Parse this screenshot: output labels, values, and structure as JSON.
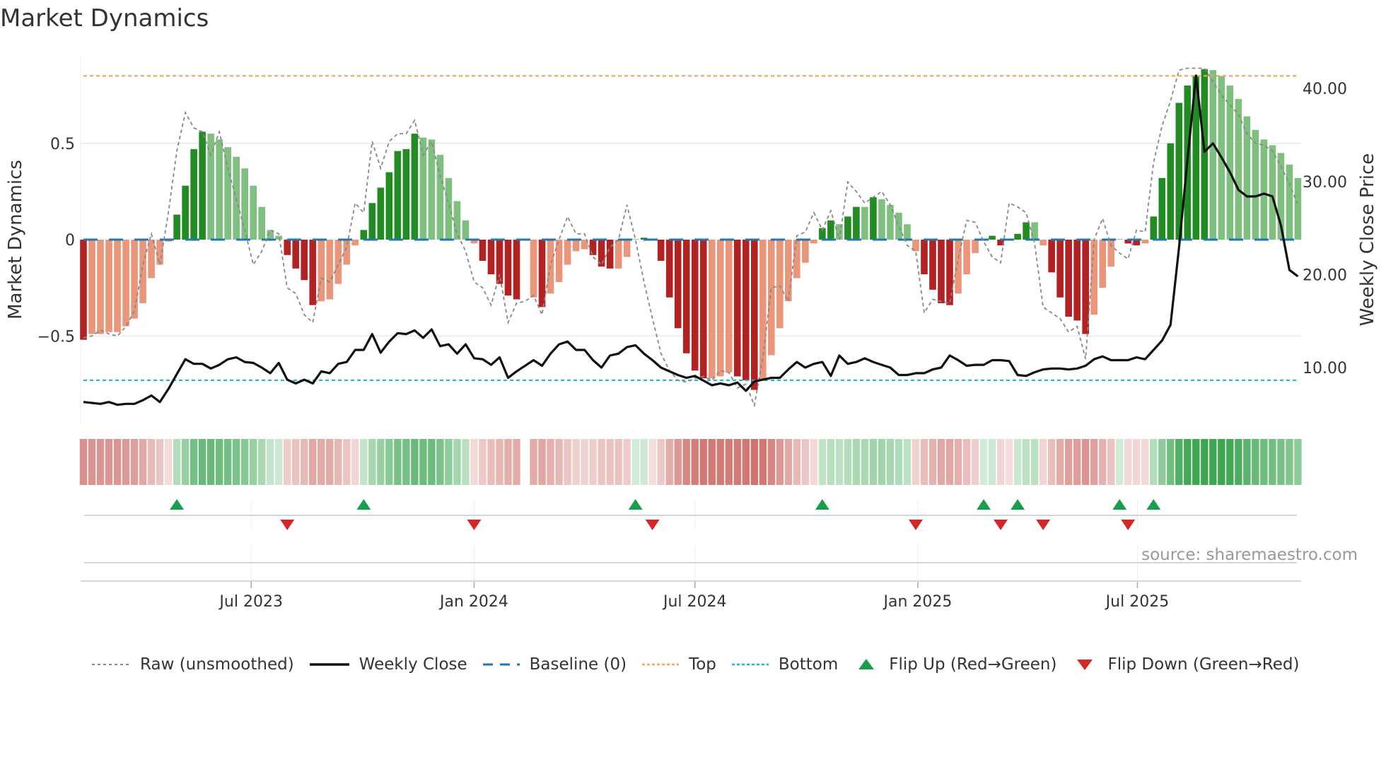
{
  "title": "Market Dynamics",
  "source": "source: sharemaestro.com",
  "colors": {
    "dark_green": "#228b22",
    "light_green": "#7fbf7f",
    "dark_red": "#b22222",
    "light_red": "#e9967a",
    "heat_green": "#3ca651",
    "heat_red": "#cd6b66",
    "raw": "#888888",
    "close": "#111111",
    "baseline": "#1f77b4",
    "top": "#f4a460",
    "bottom": "#17becf",
    "flip_up": "#1a9e4b",
    "flip_down": "#d62728"
  },
  "legend": {
    "raw": "Raw (unsmoothed)",
    "close": "Weekly Close",
    "baseline": "Baseline (0)",
    "top": "Top",
    "bottom": "Bottom",
    "flip_up": "Flip Up (Red→Green)",
    "flip_down": "Flip Down (Green→Red)"
  },
  "chart_data": {
    "type": "bar",
    "title": "Market Dynamics",
    "ylabel": "Market Dynamics",
    "y2label": "Weekly Close Price",
    "ylim": [
      -0.92,
      0.95
    ],
    "y2lim": [
      4.0,
      45.0
    ],
    "yticks": [
      {
        "value": 0.5,
        "label": "0.5"
      },
      {
        "value": 0,
        "label": "0"
      },
      {
        "value": -0.5,
        "label": "−0.5"
      }
    ],
    "y2ticks": [
      {
        "value": 40,
        "label": "40.00"
      },
      {
        "value": 30,
        "label": "30.00"
      },
      {
        "value": 20,
        "label": "20.00"
      },
      {
        "value": 10,
        "label": "10.00"
      }
    ],
    "xticks": [
      {
        "week": 19.75,
        "label": "Jul 2023"
      },
      {
        "week": 46.0,
        "label": "Jan 2024"
      },
      {
        "week": 72.0,
        "label": "Jul 2024"
      },
      {
        "week": 98.25,
        "label": "Jan 2025"
      },
      {
        "week": 124.1,
        "label": "Jul 2025"
      }
    ],
    "top_level": 0.85,
    "bottom_level": -0.73,
    "baseline": 0,
    "smoothed": [
      -0.52,
      -0.49,
      -0.49,
      -0.48,
      -0.48,
      -0.45,
      -0.41,
      -0.33,
      -0.2,
      -0.13,
      -0.01,
      0.13,
      0.28,
      0.47,
      0.56,
      0.55,
      0.52,
      0.48,
      0.43,
      0.37,
      0.28,
      0.17,
      0.05,
      0.02,
      -0.08,
      -0.15,
      -0.21,
      -0.34,
      -0.32,
      -0.31,
      -0.23,
      -0.13,
      -0.03,
      0.05,
      0.19,
      0.27,
      0.35,
      0.46,
      0.47,
      0.55,
      0.53,
      0.52,
      0.44,
      0.32,
      0.2,
      0.1,
      -0.02,
      -0.11,
      -0.18,
      -0.23,
      -0.29,
      -0.31,
      null,
      -0.3,
      -0.35,
      -0.28,
      -0.22,
      -0.13,
      -0.06,
      -0.05,
      -0.08,
      -0.14,
      -0.15,
      -0.15,
      -0.09,
      0.003,
      0.01,
      -0.005,
      -0.11,
      -0.3,
      -0.46,
      -0.59,
      -0.68,
      -0.72,
      -0.72,
      -0.71,
      -0.69,
      -0.71,
      -0.73,
      -0.78,
      -0.73,
      -0.6,
      -0.46,
      -0.32,
      -0.2,
      -0.12,
      -0.02,
      0.06,
      0.1,
      0.08,
      0.12,
      0.17,
      0.17,
      0.22,
      0.21,
      0.18,
      0.14,
      0.08,
      -0.06,
      -0.18,
      -0.26,
      -0.33,
      -0.34,
      -0.28,
      -0.18,
      -0.07,
      0.003,
      0.02,
      -0.03,
      -0.003,
      0.03,
      0.09,
      0.09,
      -0.03,
      -0.17,
      -0.3,
      -0.4,
      -0.42,
      -0.49,
      -0.39,
      -0.25,
      -0.14,
      0.003,
      -0.02,
      -0.03,
      -0.02,
      0.12,
      0.32,
      0.5,
      0.71,
      0.8,
      0.85,
      0.885,
      0.88,
      0.85,
      0.8,
      0.73,
      0.64,
      0.57,
      0.52,
      0.49,
      0.45,
      0.39,
      0.32
    ],
    "raw": [
      -0.51,
      -0.5,
      -0.47,
      -0.49,
      -0.5,
      -0.45,
      -0.37,
      -0.13,
      0.03,
      -0.13,
      0.14,
      0.46,
      0.66,
      0.58,
      0.56,
      0.44,
      0.56,
      0.37,
      0.21,
      0.05,
      -0.13,
      -0.06,
      0.05,
      0.03,
      -0.25,
      -0.28,
      -0.39,
      -0.43,
      -0.2,
      -0.22,
      -0.13,
      -0.04,
      0.19,
      0.14,
      0.51,
      0.37,
      0.51,
      0.55,
      0.55,
      0.62,
      0.44,
      0.51,
      0.33,
      0.19,
      0.03,
      -0.06,
      -0.22,
      -0.25,
      -0.34,
      -0.18,
      -0.43,
      -0.33,
      -0.32,
      -0.29,
      -0.39,
      -0.13,
      0.0,
      0.12,
      0.03,
      0.03,
      -0.09,
      -0.13,
      -0.04,
      0.0,
      0.18,
      0.0,
      -0.22,
      -0.41,
      -0.59,
      -0.68,
      -0.73,
      -0.74,
      -0.72,
      -0.71,
      -0.73,
      -0.68,
      -0.69,
      -0.77,
      -0.75,
      -0.86,
      -0.61,
      -0.25,
      -0.24,
      -0.32,
      0.02,
      0.04,
      0.14,
      0.05,
      0.15,
      0.0,
      0.3,
      0.25,
      0.19,
      0.22,
      0.25,
      0.18,
      0.07,
      -0.03,
      -0.06,
      -0.38,
      -0.31,
      -0.32,
      -0.33,
      -0.1,
      0.1,
      0.09,
      -0.01,
      -0.09,
      -0.12,
      0.19,
      0.17,
      0.14,
      -0.02,
      -0.35,
      -0.38,
      -0.41,
      -0.48,
      -0.45,
      -0.62,
      0.0,
      0.11,
      -0.03,
      -0.07,
      -0.1,
      0.05,
      0.04,
      0.4,
      0.59,
      0.72,
      0.88,
      0.89,
      0.89,
      0.89,
      0.82,
      0.75,
      0.7,
      0.65,
      0.55,
      0.5,
      0.49,
      0.46,
      0.38,
      0.29,
      0.18
    ],
    "close": [
      6.3,
      6.2,
      6.1,
      6.3,
      6.0,
      6.1,
      6.1,
      6.5,
      7.0,
      6.3,
      7.7,
      9.3,
      10.9,
      10.4,
      10.4,
      9.9,
      10.3,
      10.9,
      11.1,
      10.6,
      10.5,
      10.0,
      9.4,
      10.5,
      8.7,
      8.3,
      8.7,
      8.3,
      9.6,
      9.4,
      10.4,
      10.6,
      11.9,
      11.9,
      13.6,
      11.6,
      12.8,
      13.7,
      13.6,
      14.0,
      13.2,
      14.1,
      12.3,
      12.5,
      11.5,
      12.5,
      11.0,
      10.9,
      10.3,
      11.1,
      8.9,
      9.6,
      10.2,
      10.8,
      10.2,
      11.5,
      12.5,
      12.8,
      11.9,
      11.9,
      10.8,
      10.0,
      11.3,
      11.5,
      12.2,
      12.4,
      11.5,
      10.8,
      10.0,
      9.6,
      9.2,
      8.9,
      9.1,
      8.6,
      8.1,
      8.3,
      8.1,
      8.4,
      7.5,
      8.5,
      8.7,
      8.9,
      8.9,
      9.8,
      10.6,
      10.0,
      10.4,
      10.6,
      9.1,
      11.3,
      10.4,
      10.6,
      11.0,
      10.6,
      10.3,
      10.0,
      9.2,
      9.2,
      9.4,
      9.4,
      9.8,
      10.0,
      11.3,
      10.8,
      10.2,
      10.3,
      10.3,
      10.8,
      10.8,
      10.7,
      9.2,
      9.1,
      9.5,
      9.8,
      9.9,
      9.9,
      9.8,
      9.9,
      10.2,
      10.9,
      11.2,
      10.8,
      10.8,
      10.8,
      11.1,
      10.9,
      11.9,
      12.9,
      14.6,
      22.9,
      32.4,
      41.4,
      33.2,
      34.1,
      32.6,
      31.0,
      29.1,
      28.4,
      28.4,
      28.7,
      28.4,
      25.3,
      20.5,
      19.8
    ],
    "flip_up_weeks": [
      11,
      33,
      65,
      87,
      106,
      110,
      122,
      126
    ],
    "flip_down_weeks": [
      24,
      46,
      67,
      98,
      108,
      113,
      123
    ]
  }
}
